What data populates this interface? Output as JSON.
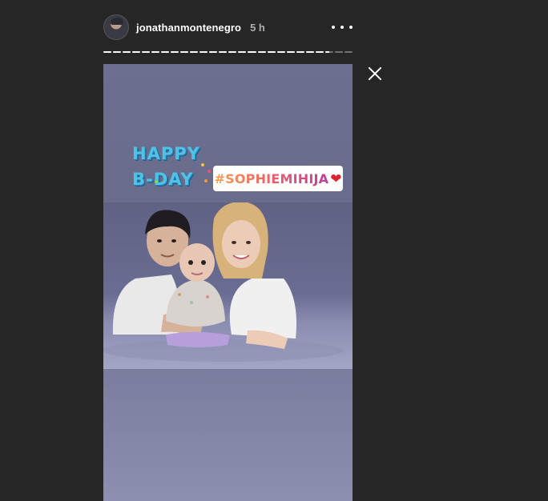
{
  "header": {
    "username": "jonathanmontenegro",
    "time": "5 h",
    "avatar_icon": "avatar-photo",
    "more_icon": "more-horizontal-icon",
    "close_icon": "close-icon"
  },
  "progress": {
    "segments_total": 26,
    "current_segment": 24,
    "current_fill": 0.5
  },
  "story": {
    "bday_line1": "HAPPY",
    "bday_line2": "B-DAY",
    "hashtag": "#SOPHIEMIHIJA",
    "hashtag_emoji": "❤"
  },
  "colors": {
    "background": "#262626",
    "story_bg": "#6d6f90",
    "bday_text": "#4fc3e6",
    "heart": "#e0242f"
  }
}
